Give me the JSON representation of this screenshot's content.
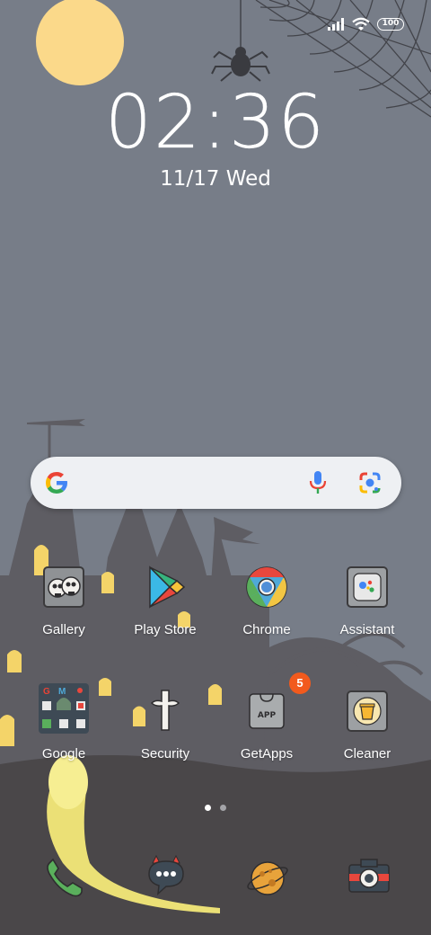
{
  "status_bar": {
    "battery": "100",
    "signal_icon": "signal-icon",
    "wifi_icon": "wifi-icon"
  },
  "lock": {
    "time": "02:36",
    "date": "11/17 Wed"
  },
  "search": {
    "logo": "google-g-icon",
    "mic_icon": "mic-icon",
    "lens_icon": "lens-icon"
  },
  "apps": [
    {
      "label": "Gallery",
      "icon": "gallery-icon"
    },
    {
      "label": "Play Store",
      "icon": "play-store-icon"
    },
    {
      "label": "Chrome",
      "icon": "chrome-icon"
    },
    {
      "label": "Assistant",
      "icon": "assistant-icon"
    },
    {
      "label": "Google",
      "icon": "google-folder-icon"
    },
    {
      "label": "Security",
      "icon": "security-icon"
    },
    {
      "label": "GetApps",
      "icon": "getapps-icon",
      "badge": "5"
    },
    {
      "label": "Cleaner",
      "icon": "cleaner-icon"
    }
  ],
  "pages": {
    "count": 2,
    "active": 0
  },
  "dock": [
    {
      "icon": "phone-icon"
    },
    {
      "icon": "messages-icon"
    },
    {
      "icon": "browser-icon"
    },
    {
      "icon": "camera-icon"
    }
  ],
  "colors": {
    "sky": "#777d88",
    "ground": "#4a4749",
    "moon": "#fbd98a",
    "window_glow": "#f4d469",
    "badge": "#f25a1d"
  }
}
